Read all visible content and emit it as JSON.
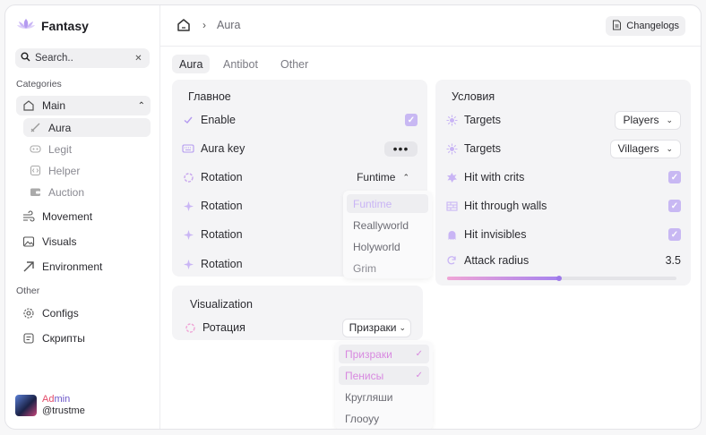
{
  "app": {
    "name": "Fantasy"
  },
  "search": {
    "placeholder": "Search.."
  },
  "sidebar": {
    "categories_label": "Categories",
    "other_label": "Other",
    "main": {
      "label": "Main"
    },
    "sub_items": [
      "Aura",
      "Legit",
      "Helper",
      "Auction"
    ],
    "items": [
      "Movement",
      "Visuals",
      "Environment"
    ],
    "other_items": [
      "Configs",
      "Скрипты"
    ]
  },
  "user": {
    "name_part1": "Ad",
    "name_part2": "min",
    "handle": "@trustme"
  },
  "header": {
    "breadcrumb": "Aura",
    "changelogs": "Changelogs"
  },
  "tabs": [
    "Aura",
    "Antibot",
    "Other"
  ],
  "main_panel": {
    "title": "Главное",
    "rows": [
      {
        "label": "Enable",
        "control": "checkbox",
        "checked": true
      },
      {
        "label": "Aura key",
        "control": "more"
      },
      {
        "label": "Rotation",
        "control": "select",
        "value": "Funtime"
      },
      {
        "label": "Rotation"
      },
      {
        "label": "Rotation"
      },
      {
        "label": "Rotation"
      }
    ],
    "rotation_dropdown": [
      "Funtime",
      "Reallyworld",
      "Holyworld",
      "Grim"
    ]
  },
  "conditions_panel": {
    "title": "Условия",
    "targets_1": {
      "label": "Targets",
      "value": "Players"
    },
    "targets_2": {
      "label": "Targets",
      "value": "Villagers"
    },
    "checks": [
      {
        "label": "Hit with crits",
        "checked": true
      },
      {
        "label": "Hit through walls",
        "checked": true
      },
      {
        "label": "Hit invisibles",
        "checked": true
      }
    ],
    "attack_radius": {
      "label": "Attack radius",
      "value": "3.5",
      "fraction": 0.49
    }
  },
  "visualization_panel": {
    "title": "Visualization",
    "row_label": "Ротация",
    "value": "Призраки",
    "dropdown": [
      {
        "label": "Призраки",
        "selected": true
      },
      {
        "label": "Пенисы",
        "selected": true
      },
      {
        "label": "Кругляши",
        "selected": false
      },
      {
        "label": "Глооуу",
        "selected": false
      }
    ]
  },
  "colors": {
    "accent": "#b49af0",
    "pink": "#d889e0",
    "panel": "#f4f4f6"
  }
}
